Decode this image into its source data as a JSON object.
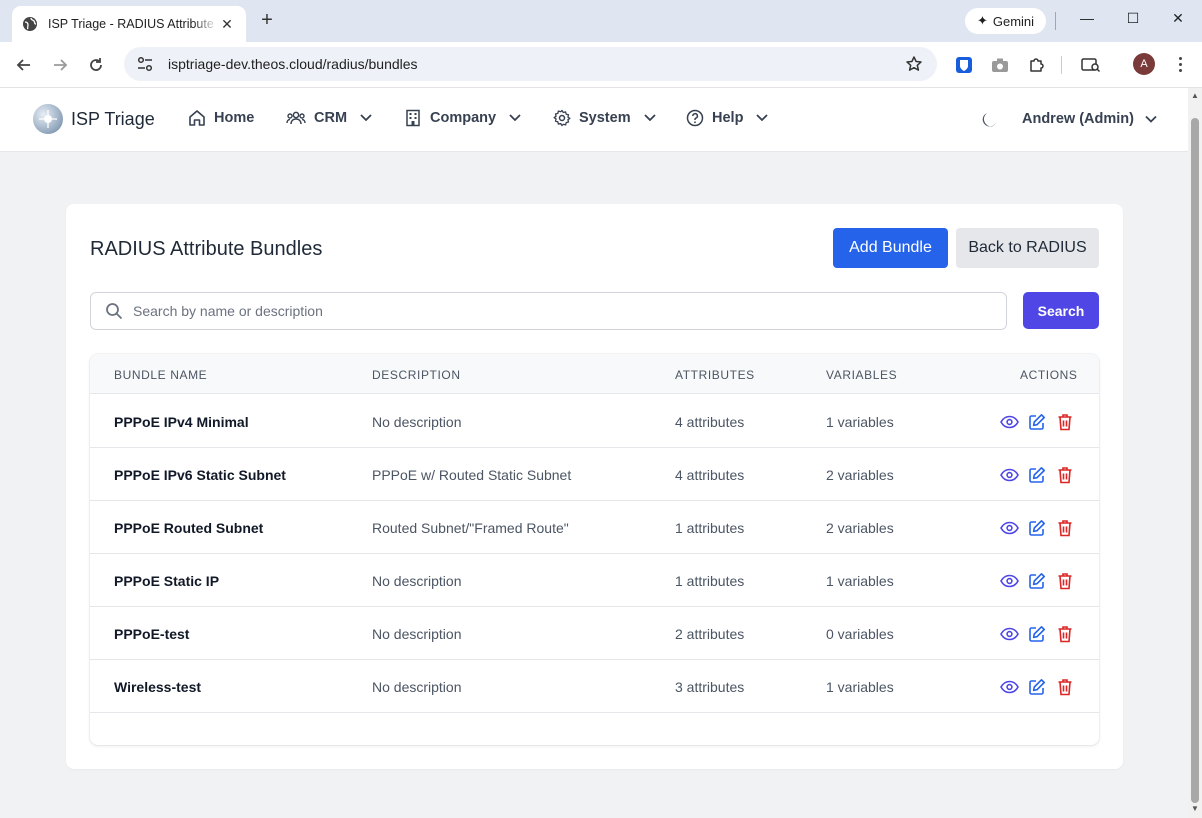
{
  "browser": {
    "tab_title": "ISP Triage - RADIUS Attribute Bundles",
    "url": "isptriage-dev.theos.cloud/radius/bundles",
    "gemini_label": "Gemini",
    "profile_initial": "A"
  },
  "nav": {
    "brand": "ISP Triage",
    "items": [
      {
        "label": "Home",
        "icon": "home-icon"
      },
      {
        "label": "CRM",
        "icon": "users-icon"
      },
      {
        "label": "Company",
        "icon": "building-icon"
      },
      {
        "label": "System",
        "icon": "gear-icon"
      },
      {
        "label": "Help",
        "icon": "help-circle-icon"
      }
    ],
    "user": "Andrew (Admin)"
  },
  "page": {
    "title": "RADIUS Attribute Bundles",
    "add_button": "Add Bundle",
    "back_button": "Back to RADIUS",
    "search_placeholder": "Search by name or description",
    "search_button": "Search"
  },
  "table": {
    "headers": [
      "BUNDLE NAME",
      "DESCRIPTION",
      "ATTRIBUTES",
      "VARIABLES",
      "ACTIONS"
    ],
    "rows": [
      {
        "name": "PPPoE IPv4 Minimal",
        "description": "No description",
        "attributes": "4 attributes",
        "variables": "1 variables"
      },
      {
        "name": "PPPoE IPv6 Static Subnet",
        "description": "PPPoE w/ Routed Static Subnet",
        "attributes": "4 attributes",
        "variables": "2 variables"
      },
      {
        "name": "PPPoE Routed Subnet",
        "description": "Routed Subnet/\"Framed Route\"",
        "attributes": "1 attributes",
        "variables": "2 variables"
      },
      {
        "name": "PPPoE Static IP",
        "description": "No description",
        "attributes": "1 attributes",
        "variables": "1 variables"
      },
      {
        "name": "PPPoE-test",
        "description": "No description",
        "attributes": "2 attributes",
        "variables": "0 variables"
      },
      {
        "name": "Wireless-test",
        "description": "No description",
        "attributes": "3 attributes",
        "variables": "1 variables"
      }
    ]
  },
  "colors": {
    "primary": "#2563eb",
    "search": "#4f46e5",
    "view": "#4f46e5",
    "edit": "#2563eb",
    "delete": "#dc2626"
  }
}
